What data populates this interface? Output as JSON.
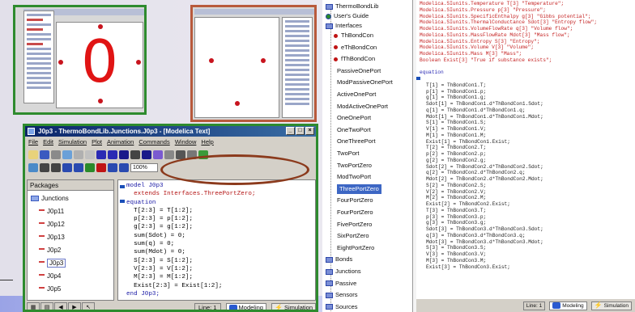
{
  "panel_a": {
    "glyph": "0"
  },
  "main_window": {
    "title": "J0p3 - ThermoBondLib.Junctions.J0p3 - [Modelica Text]",
    "menu": [
      "File",
      "Edit",
      "Simulation",
      "Plot",
      "Animation",
      "Commands",
      "Window",
      "Help"
    ],
    "zoom": "100%",
    "packages_header": "Packages",
    "packages": [
      {
        "label": "Junctions",
        "kind": "folder"
      },
      {
        "label": "J0p11",
        "kind": "junction"
      },
      {
        "label": "J0p12",
        "kind": "junction"
      },
      {
        "label": "J0p13",
        "kind": "junction"
      },
      {
        "label": "J0p2",
        "kind": "junction"
      },
      {
        "label": "J0p3",
        "kind": "junction",
        "selected": true
      },
      {
        "label": "J0p4",
        "kind": "junction"
      },
      {
        "label": "J0p5",
        "kind": "junction"
      }
    ],
    "code": [
      "model J0p3",
      "  extends Interfaces.ThreePortZero;",
      "",
      "",
      "equation",
      "  T[2:3] = T[1:2];",
      "  p[2:3] = p[1:2];",
      "  g[2:3] = g[1:2];",
      "  sum(Sdot) = 0;",
      "  sum(q) = 0;",
      "  sum(Mdot) = 0;",
      "  S[2:3] = S[1:2];",
      "  V[2:3] = V[1:2];",
      "  M[2:3] = M[1:2];",
      "  Exist[2:3] = Exist[1:2];",
      "end J0p3;"
    ],
    "status": {
      "line_label": "Line:",
      "line_value": "1",
      "modeling": "Modeling",
      "simulation": "Simulation"
    }
  },
  "right_window": {
    "tree": [
      {
        "label": "ThermoBondLib",
        "kind": "root"
      },
      {
        "label": "User's Guide",
        "kind": "info"
      },
      {
        "label": "Interfaces",
        "kind": "folder"
      },
      {
        "label": "ThBondCon",
        "kind": "connector"
      },
      {
        "label": "eThBondCon",
        "kind": "connector"
      },
      {
        "label": "fThBondCon",
        "kind": "connector"
      },
      {
        "label": "PassiveOnePort",
        "kind": "item"
      },
      {
        "label": "ModPassiveOnePort",
        "kind": "item"
      },
      {
        "label": "ActiveOnePort",
        "kind": "item"
      },
      {
        "label": "ModActiveOnePort",
        "kind": "item"
      },
      {
        "label": "OneOnePort",
        "kind": "item"
      },
      {
        "label": "OneTwoPort",
        "kind": "item"
      },
      {
        "label": "OneThreePort",
        "kind": "item"
      },
      {
        "label": "TwoPort",
        "kind": "item"
      },
      {
        "label": "TwoPortZero",
        "kind": "item"
      },
      {
        "label": "ModTwoPort",
        "kind": "item"
      },
      {
        "label": "ThreePortZero",
        "kind": "item",
        "selected": true
      },
      {
        "label": "FourPortZero",
        "kind": "item"
      },
      {
        "label": "FourPortZero",
        "kind": "item"
      },
      {
        "label": "FivePortZero",
        "kind": "item"
      },
      {
        "label": "SixPortZero",
        "kind": "item"
      },
      {
        "label": "EightPortZero",
        "kind": "item"
      },
      {
        "label": "Bonds",
        "kind": "folder"
      },
      {
        "label": "Junctions",
        "kind": "folder"
      },
      {
        "label": "Passive",
        "kind": "folder"
      },
      {
        "label": "Sensors",
        "kind": "folder"
      },
      {
        "label": "Sources",
        "kind": "folder"
      }
    ],
    "declarations": [
      "Modelica.SIunits.Temperature T[3] \"Temperature\";",
      "Modelica.SIunits.Pressure p[3] \"Pressure\";",
      "Modelica.SIunits.SpecificEnthalpy g[3] \"Gibbs potential\";",
      "Modelica.SIunits.ThermalConductance Sdot[3] \"Entropy flow\";",
      "Modelica.SIunits.VolumeFlowRate q[3] \"Volume flow\";",
      "Modelica.SIunits.MassFlowRate Mdot[3] \"Mass flow\";",
      "Modelica.SIunits.Entropy S[3] \"Entropy\";",
      "Modelica.SIunits.Volume V[3] \"Volume\";",
      "Modelica.SIunits.Mass M[3] \"Mass\";",
      "Boolean Exist[3] \"True if substance exists\";"
    ],
    "equation_kw": "equation",
    "equations": [
      "T[1] = ThBondCon1.T;",
      "p[1] = ThBondCon1.p;",
      "g[1] = ThBondCon1.g;",
      "Sdot[1] = ThBondCon1.d*ThBondCon1.Sdot;",
      "q[1] = ThBondCon1.d*ThBondCon1.q;",
      "Mdot[1] = ThBondCon1.d*ThBondCon1.Mdot;",
      "S[1] = ThBondCon1.S;",
      "V[1] = ThBondCon1.V;",
      "M[1] = ThBondCon1.M;",
      "Exist[1] = ThBondCon1.Exist;",
      "T[2] = ThBondCon2.T;",
      "p[2] = ThBondCon2.p;",
      "g[2] = ThBondCon2.g;",
      "Sdot[2] = ThBondCon2.d*ThBondCon2.Sdot;",
      "q[2] = ThBondCon2.d*ThBondCon2.q;",
      "Mdot[2] = ThBondCon2.d*ThBondCon2.Mdot;",
      "S[2] = ThBondCon2.S;",
      "V[2] = ThBondCon2.V;",
      "M[2] = ThBondCon2.M;",
      "Exist[2] = ThBondCon2.Exist;",
      "T[3] = ThBondCon3.T;",
      "p[3] = ThBondCon3.p;",
      "g[3] = ThBondCon3.g;",
      "Sdot[3] = ThBondCon3.d*ThBondCon3.Sdot;",
      "q[3] = ThBondCon3.d*ThBondCon3.q;",
      "Mdot[3] = ThBondCon3.d*ThBondCon3.Mdot;",
      "S[3] = ThBondCon3.S;",
      "V[3] = ThBondCon3.V;",
      "M[3] = ThBondCon3.M;",
      "Exist[3] = ThBondCon3.Exist;"
    ],
    "status": {
      "line_label": "Line:",
      "line_value": "1",
      "modeling": "Modeling",
      "simulation": "Simulation"
    }
  },
  "colors": {
    "highlight_frame": "#2e8b2e",
    "oval": "#8b3a1c",
    "zero": "#e01414",
    "selection": "#3d67c4"
  }
}
